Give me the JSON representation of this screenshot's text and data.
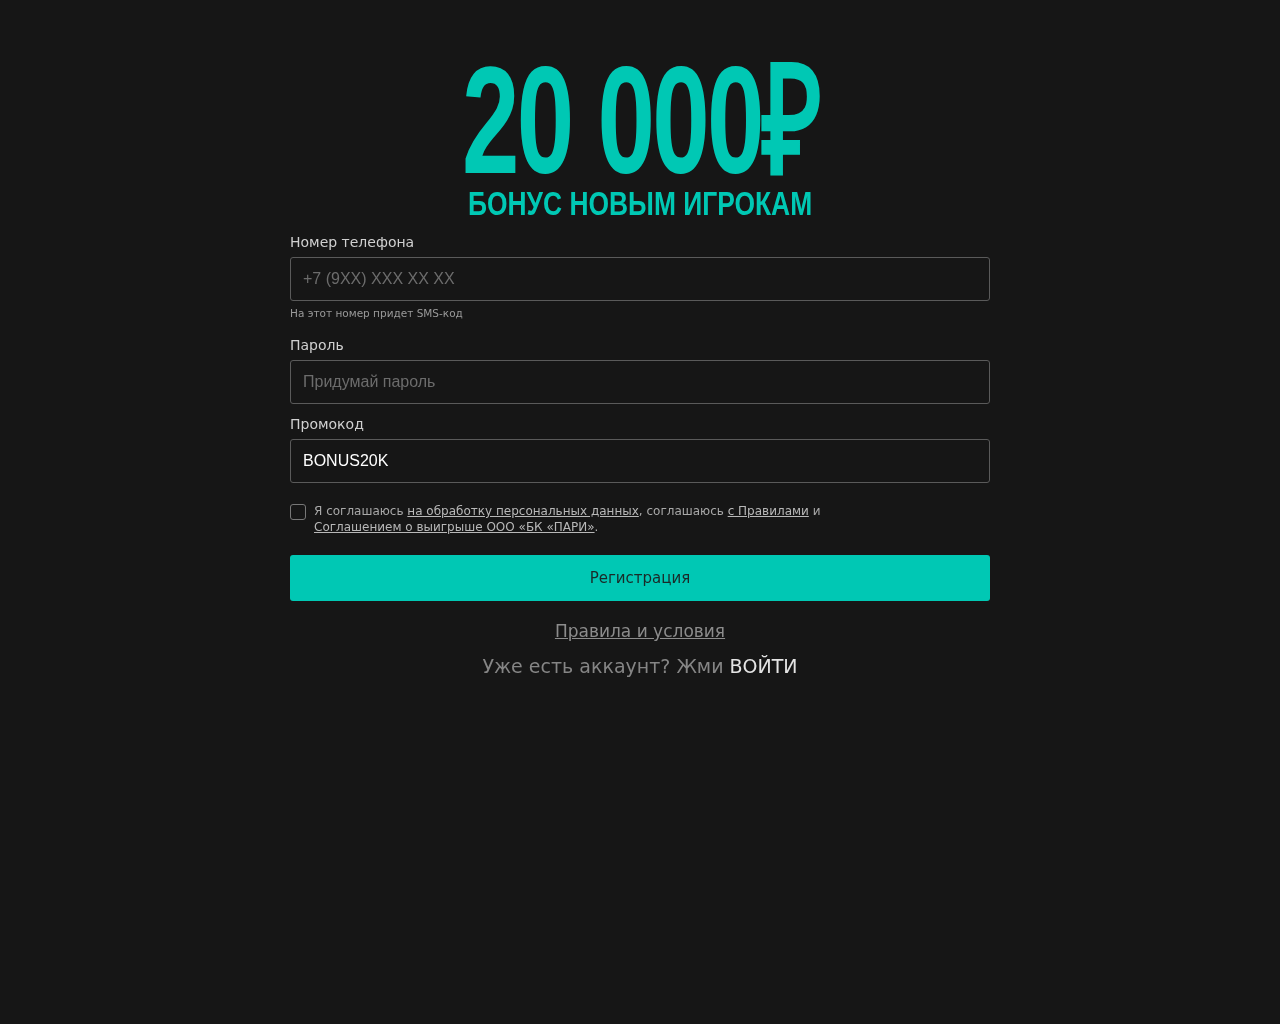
{
  "promo": {
    "amount": "20 000₽",
    "subtitle": "БОНУС НОВЫМ ИГРОКАМ"
  },
  "fields": [
    {
      "label": "Номер телефона",
      "placeholder": "+7 (9XX) XXX XX XX",
      "hint": "На этот номер придет SMS-код"
    },
    {
      "label": "Пароль",
      "placeholder": "Придумай пароль"
    },
    {
      "label": "Промокод",
      "value": "BONUS20K"
    }
  ],
  "consent": {
    "checked": false,
    "parts": [
      {
        "text": "Я соглашаюсь ",
        "link": false
      },
      {
        "text": "на обработку персональных данных",
        "link": true
      },
      {
        "text": ", соглашаюсь ",
        "link": false
      },
      {
        "text": "с Правилами",
        "link": true
      },
      {
        "text": " и ",
        "link": false
      },
      {
        "text": "Соглашением о выигрыше ООО «БК «ПАРИ»",
        "link": true
      },
      {
        "text": ".",
        "link": false
      }
    ]
  },
  "submit": "Регистрация",
  "rules_link": "Правила и условия",
  "login": {
    "text": "Уже есть аккаунт? Жми",
    "link": "ВОЙТИ"
  }
}
